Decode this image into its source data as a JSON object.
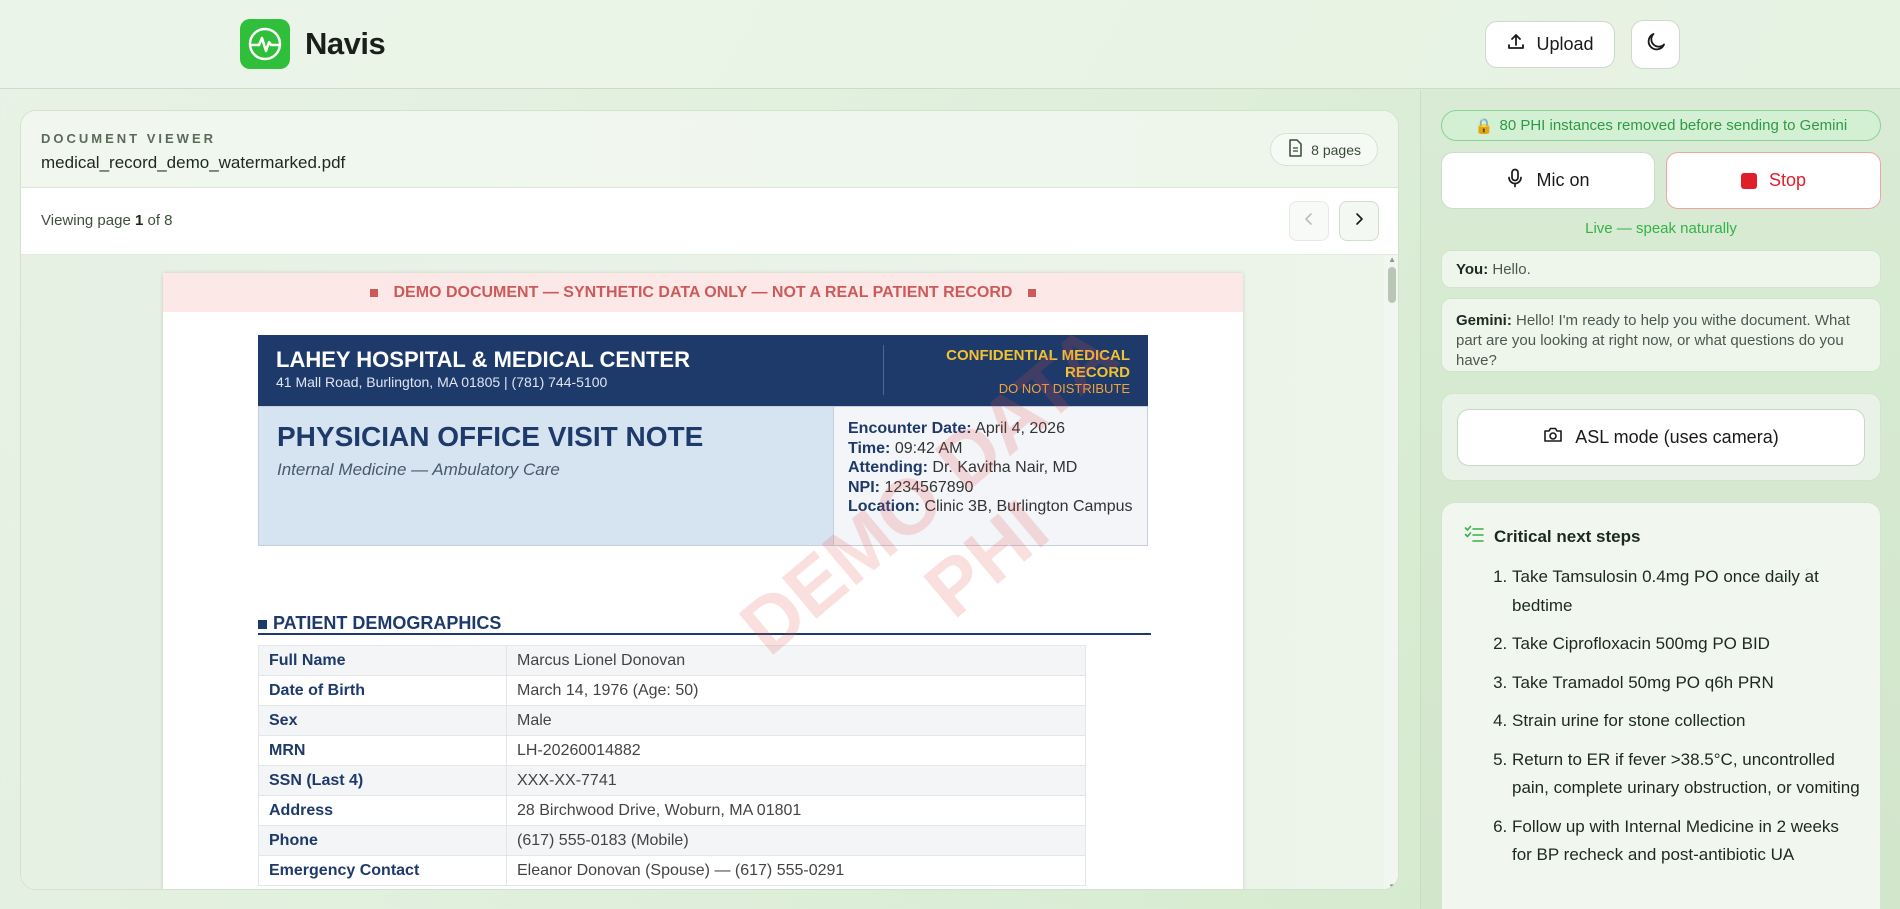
{
  "app": {
    "name": "Navis",
    "upload_label": "Upload",
    "logo_icon": "pulse-icon",
    "theme_icon": "moon-icon"
  },
  "viewer": {
    "label": "DOCUMENT VIEWER",
    "filename": "medical_record_demo_watermarked.pdf",
    "pages_badge": "8 pages",
    "viewing_prefix": "Viewing page ",
    "current_page": "1",
    "viewing_mid": " of ",
    "total_pages": "8"
  },
  "document": {
    "banner": "DEMO DOCUMENT — SYNTHETIC DATA ONLY — NOT A REAL PATIENT RECORD",
    "hospital_name": "LAHEY HOSPITAL & MEDICAL CENTER",
    "hospital_address": "41 Mall Road, Burlington, MA 01805   |   (781) 744-5100",
    "confidential": "CONFIDENTIAL MEDICAL RECORD",
    "do_not_distribute": "DO NOT DISTRIBUTE",
    "visit_title": "PHYSICIAN OFFICE VISIT NOTE",
    "visit_subtitle": "Internal Medicine — Ambulatory Care",
    "encounter": [
      {
        "label": "Encounter Date:",
        "value": " April 4, 2026"
      },
      {
        "label": "Time:",
        "value": " 09:42 AM"
      },
      {
        "label": "Attending:",
        "value": " Dr. Kavitha Nair, MD"
      },
      {
        "label": "NPI:",
        "value": " 1234567890"
      },
      {
        "label": "Location:",
        "value": " Clinic 3B, Burlington Campus"
      }
    ],
    "section_title": "PATIENT DEMOGRAPHICS",
    "demographics": [
      {
        "k": "Full Name",
        "v": "Marcus Lionel Donovan"
      },
      {
        "k": "Date of Birth",
        "v": "March 14, 1976 (Age: 50)"
      },
      {
        "k": "Sex",
        "v": "Male"
      },
      {
        "k": "MRN",
        "v": "LH-20260014882"
      },
      {
        "k": "SSN (Last 4)",
        "v": "XXX-XX-7741"
      },
      {
        "k": "Address",
        "v": "28 Birchwood Drive, Woburn, MA 01801"
      },
      {
        "k": "Phone",
        "v": "(617) 555-0183 (Mobile)"
      },
      {
        "k": "Emergency Contact",
        "v": "Eleanor Donovan (Spouse) — (617) 555-0291"
      }
    ],
    "watermark_line1": "DEMO DATA",
    "watermark_line2": "PHI"
  },
  "assistant": {
    "phi_notice": "80 PHI instances removed before sending to Gemini",
    "mic_label": "Mic on",
    "stop_label": "Stop",
    "live_status": "Live — speak naturally",
    "messages": [
      {
        "speaker": "You:",
        "text": " Hello."
      },
      {
        "speaker": "Gemini:",
        "text": " Hello! I'm ready to help you withe document. What part are you looking at right now, or what questions do you have?"
      }
    ],
    "asl_label": "ASL mode (uses camera)",
    "steps_title": "Critical next steps",
    "steps": [
      "Take Tamsulosin 0.4mg PO once daily at bedtime",
      "Take Ciprofloxacin 500mg PO BID",
      "Take Tramadol 50mg PO q6h PRN",
      "Strain urine for stone collection",
      "Return to ER if fever >38.5°C, uncontrolled pain, complete urinary obstruction, or vomiting",
      "Follow up with Internal Medicine in 2 weeks for BP recheck and post-antibiotic UA"
    ]
  },
  "colors": {
    "brand_green": "#2fbf3a",
    "navy": "#1e3a6b",
    "stop_red": "#e11d2a",
    "live_green": "#35b24a"
  }
}
